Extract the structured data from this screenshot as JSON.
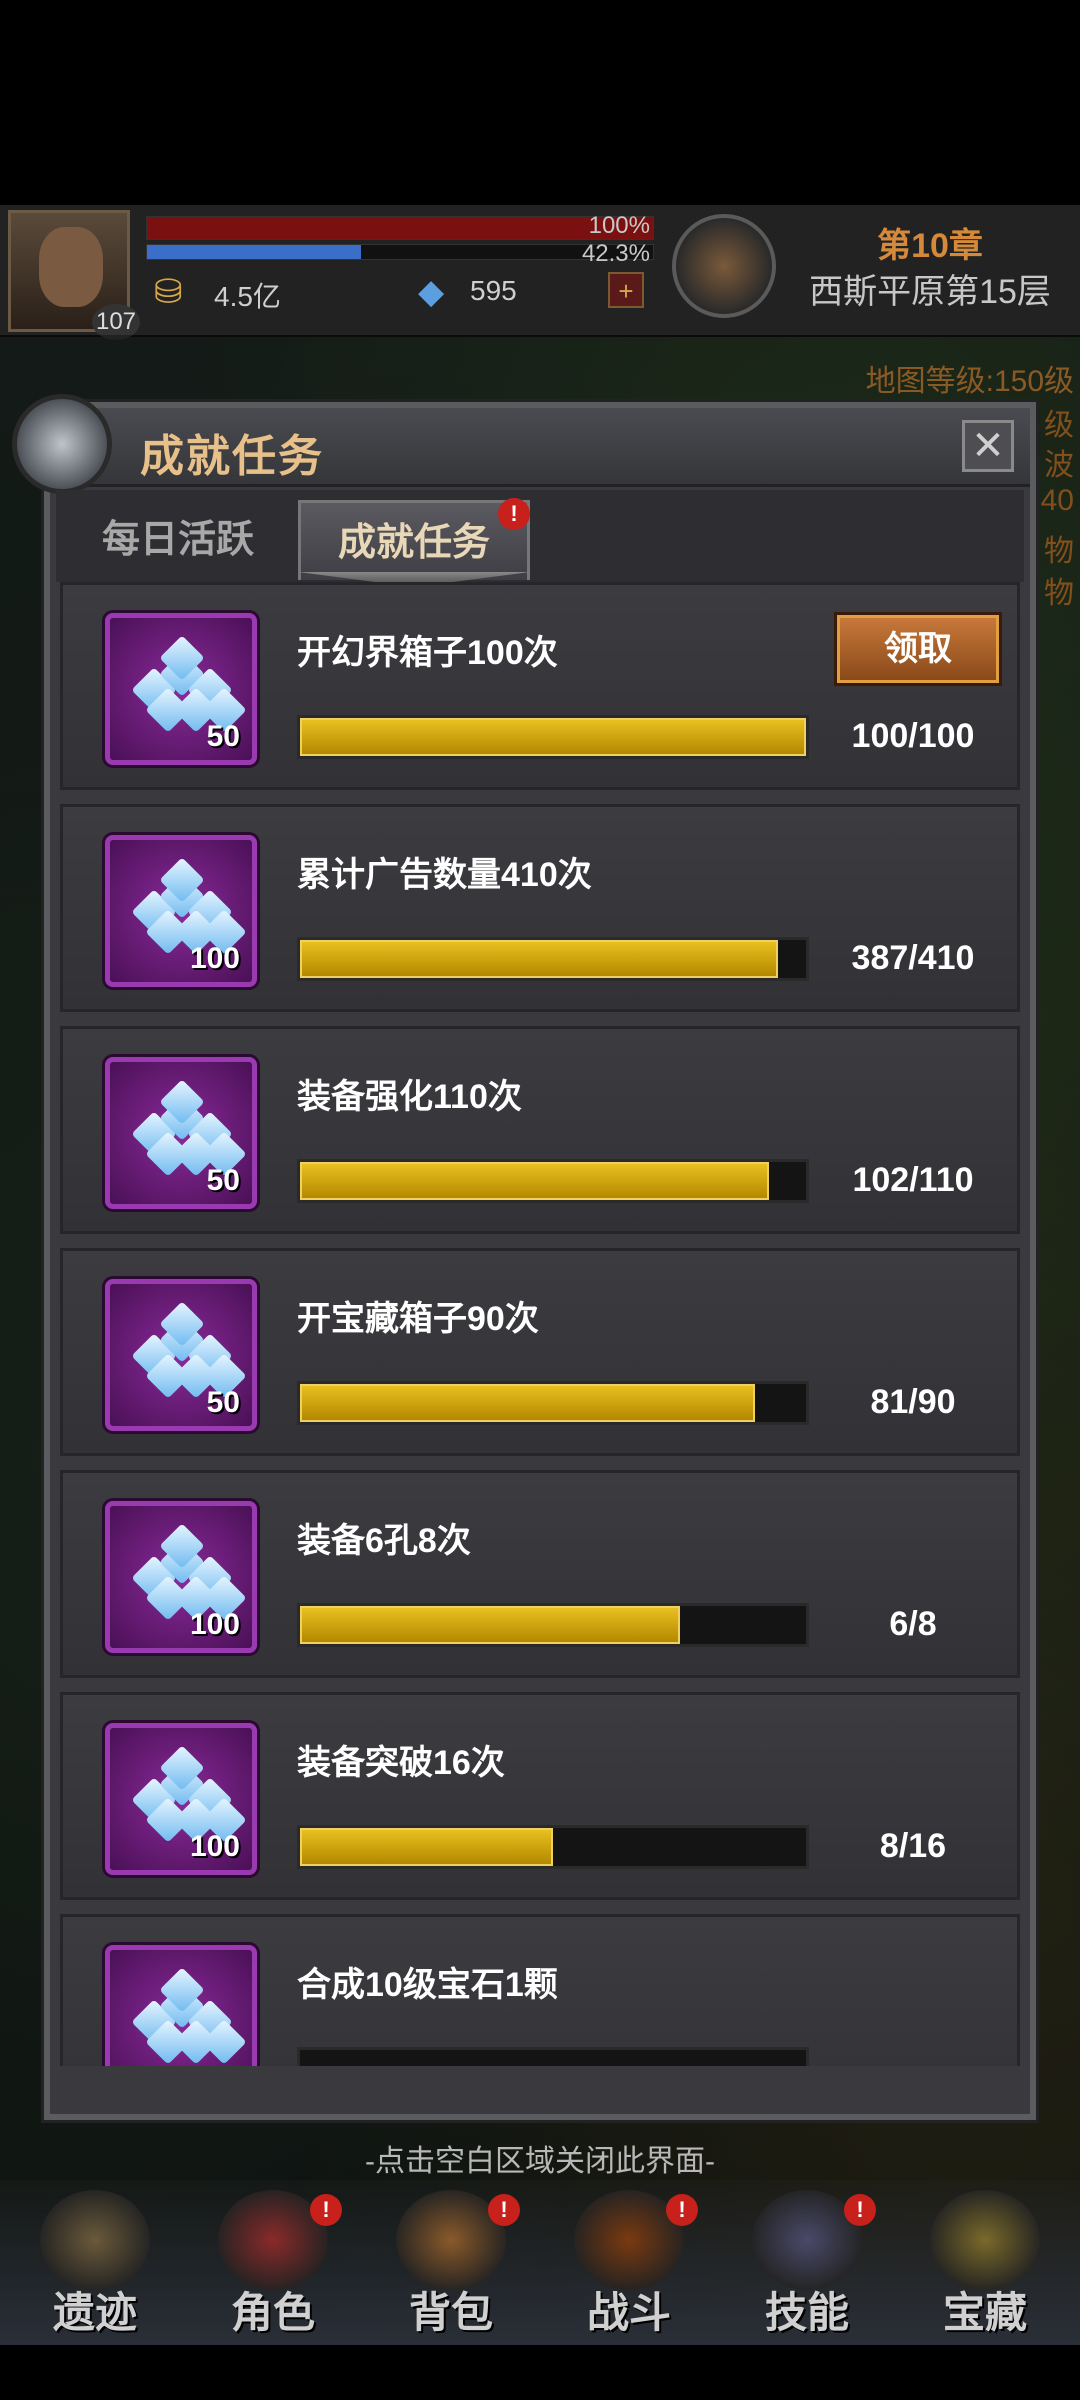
{
  "hud": {
    "level": "107",
    "hp_pct": "100%",
    "exp_pct": "42.3%",
    "gold": "4.5亿",
    "gems": "595",
    "plus": "+",
    "chapter": "第10章",
    "floor": "西斯平原第15层",
    "map_level": "地图等级:150级",
    "side_chars": [
      "级",
      "波",
      "40",
      "物",
      "物"
    ]
  },
  "panel": {
    "title": "成就任务",
    "close": "✕",
    "tabs": [
      {
        "label": "每日活跃",
        "active": false
      },
      {
        "label": "成就任务",
        "active": true,
        "alert": "!"
      }
    ]
  },
  "tasks": [
    {
      "title": "开幻界箱子100次",
      "reward": "50",
      "progress_text": "100/100",
      "progress": 1.0,
      "claim_label": "领取"
    },
    {
      "title": "累计广告数量410次",
      "reward": "100",
      "progress_text": "387/410",
      "progress": 0.944
    },
    {
      "title": "装备强化110次",
      "reward": "50",
      "progress_text": "102/110",
      "progress": 0.927
    },
    {
      "title": "开宝藏箱子90次",
      "reward": "50",
      "progress_text": "81/90",
      "progress": 0.9
    },
    {
      "title": "装备6孔8次",
      "reward": "100",
      "progress_text": "6/8",
      "progress": 0.75
    },
    {
      "title": "装备突破16次",
      "reward": "100",
      "progress_text": "8/16",
      "progress": 0.5
    },
    {
      "title": "合成10级宝石1颗",
      "reward": "",
      "progress_text": "",
      "progress": 0.0
    }
  ],
  "hint": "-点击空白区域关闭此界面-",
  "nav": [
    {
      "label": "遗迹",
      "alert": ""
    },
    {
      "label": "角色",
      "alert": "!"
    },
    {
      "label": "背包",
      "alert": "!"
    },
    {
      "label": "战斗",
      "alert": "!"
    },
    {
      "label": "技能",
      "alert": "!"
    },
    {
      "label": "宝藏",
      "alert": ""
    }
  ],
  "colors": {
    "accent_gold": "#e8c020",
    "title_gold": "#e8c18a",
    "alert_red": "#c8201a",
    "icon_purple": "#8a2a9a"
  }
}
